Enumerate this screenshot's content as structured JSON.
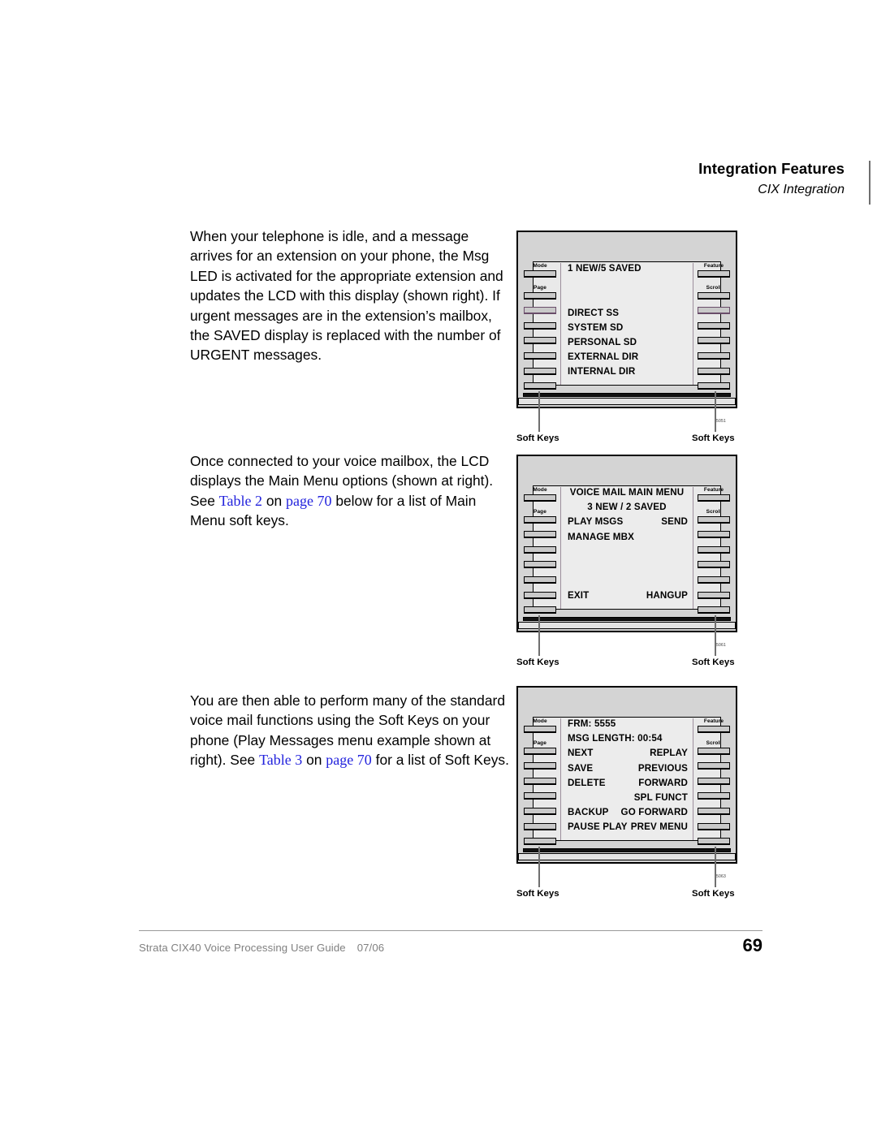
{
  "header": {
    "title": "Integration Features",
    "subtitle": "CIX Integration"
  },
  "paragraphs": {
    "p1": "When your telephone is idle, and a message arrives for an extension on your phone, the Msg LED is activated for the appropriate extension and updates the LCD with this display (shown right). If urgent messages are in the extension’s mailbox, the SAVED display is replaced with the number of URGENT messages.",
    "p2_before": "Once connected to your voice mailbox, the LCD displays the Main Menu options (shown at right). See ",
    "p2_link1": "Table 2",
    "p2_mid": " on ",
    "p2_link2": "page 70",
    "p2_after": " below for a list of Main Menu soft keys.",
    "p3_before": "You are then able to perform many of the standard voice mail functions using the Soft Keys on your phone (Play Messages menu example shown at right). See ",
    "p3_link1": "Table 3",
    "p3_mid": " on ",
    "p3_link2": "page 70",
    "p3_after": " for a list of Soft Keys."
  },
  "phone_common": {
    "key_label_mode": "Mode",
    "key_label_page": "Page",
    "key_label_feature": "Feature",
    "key_label_scroll": "Scroll",
    "soft_keys_caption": "Soft Keys"
  },
  "figures": [
    {
      "id": "5051",
      "name": "message-waiting-display",
      "lcd_rows": [
        {
          "left": "1 NEW/5 SAVED",
          "right": ""
        },
        {
          "left": "",
          "right": ""
        },
        {
          "left": "",
          "right": ""
        },
        {
          "left": "DIRECT SS",
          "right": ""
        },
        {
          "left": "SYSTEM SD",
          "right": ""
        },
        {
          "left": "PERSONAL SD",
          "right": ""
        },
        {
          "left": "EXTERNAL DIR",
          "right": ""
        },
        {
          "left": "INTERNAL DIR",
          "right": ""
        }
      ]
    },
    {
      "id": "5061",
      "name": "voice-mail-main-menu-display",
      "lcd_title": "VOICE MAIL  MAIN MENU",
      "lcd_count": "3 NEW / 2 SAVED",
      "lcd_rows": [
        {
          "left": "PLAY MSGS",
          "right": "SEND"
        },
        {
          "left": "MANAGE MBX",
          "right": ""
        },
        {
          "left": "",
          "right": ""
        },
        {
          "left": "",
          "right": ""
        },
        {
          "left": "",
          "right": ""
        },
        {
          "left": "EXIT",
          "right": "HANGUP"
        }
      ]
    },
    {
      "id": "5063",
      "name": "play-messages-menu-display",
      "lcd_rows": [
        {
          "left": "FRM: 5555",
          "right": ""
        },
        {
          "left": "MSG LENGTH: 00:54",
          "right": ""
        },
        {
          "left": "NEXT",
          "right": "REPLAY"
        },
        {
          "left": "SAVE",
          "right": "PREVIOUS"
        },
        {
          "left": "DELETE",
          "right": "FORWARD"
        },
        {
          "left": "",
          "right": "SPL FUNCT"
        },
        {
          "left": "BACKUP",
          "right": "GO FORWARD"
        },
        {
          "left": "PAUSE PLAY",
          "right": "PREV MENU"
        }
      ]
    }
  ],
  "footer": {
    "guide": "Strata CIX40 Voice Processing User Guide",
    "date": "07/06",
    "page_number": "69"
  }
}
